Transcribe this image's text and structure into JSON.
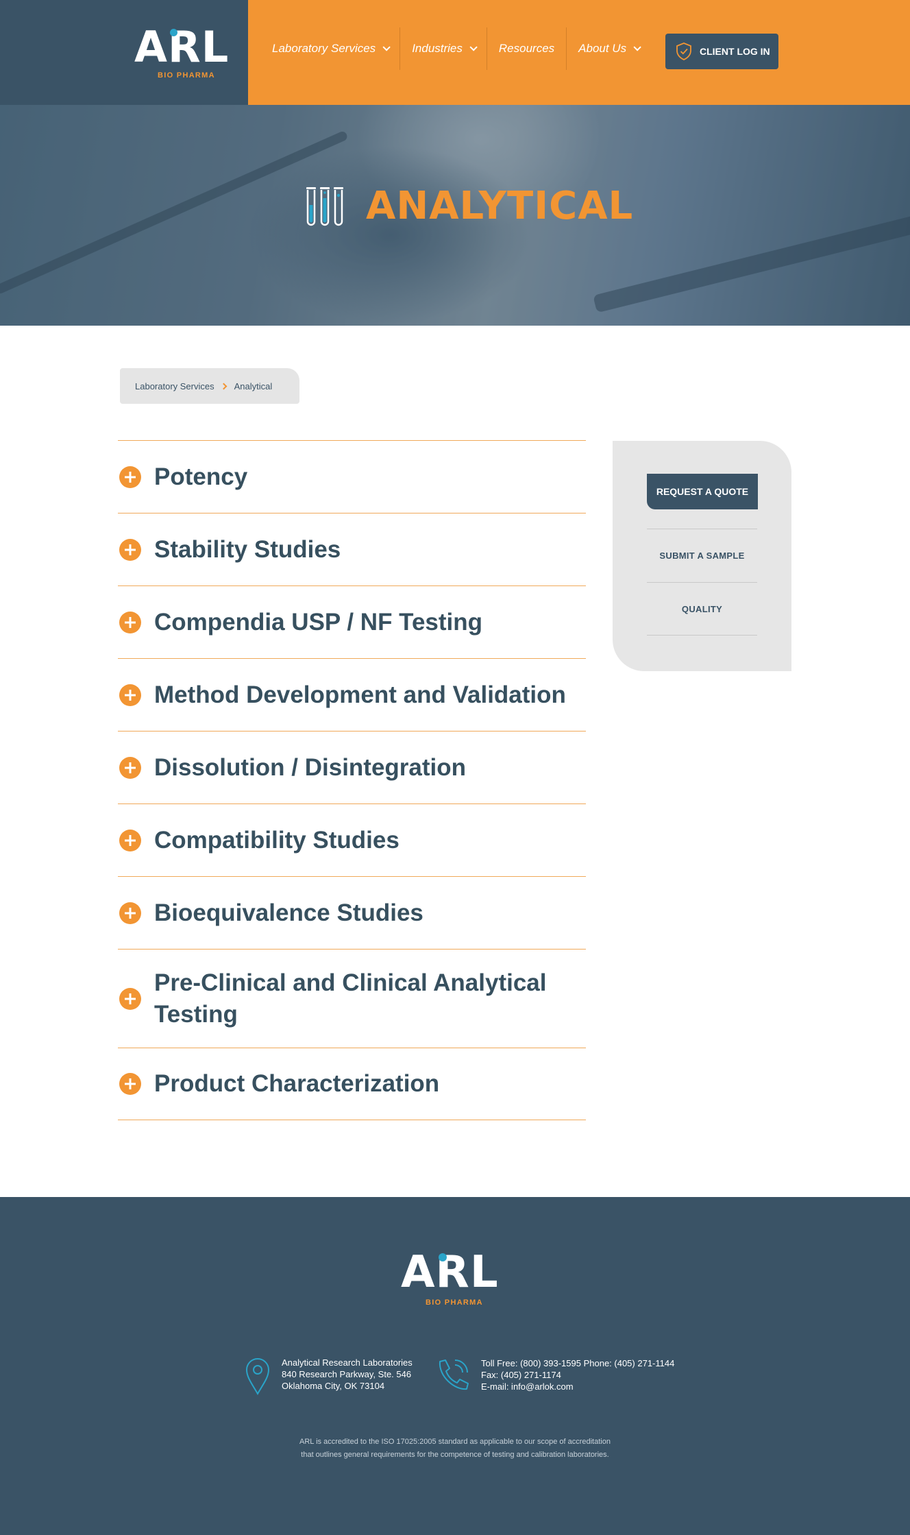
{
  "brand": {
    "logo_text": "ARL",
    "logo_subtitle": "BIO PHARMA",
    "primary_color": "#3a5366",
    "accent_color": "#f29533",
    "dot_color": "#2aa4c9"
  },
  "nav": {
    "items": [
      {
        "label": "Laboratory Services",
        "has_dropdown": true
      },
      {
        "label": "Industries",
        "has_dropdown": true
      },
      {
        "label": "Resources",
        "has_dropdown": false
      },
      {
        "label": "About Us",
        "has_dropdown": true
      }
    ],
    "client_login_label": "CLIENT LOG IN",
    "client_login_icon": "shield-check-icon"
  },
  "hero": {
    "title": "ANALYTICAL",
    "icon": "test-tubes-icon"
  },
  "breadcrumb": {
    "parent": "Laboratory Services",
    "current": "Analytical"
  },
  "accordion": {
    "items": [
      "Potency",
      "Stability Studies",
      "Compendia USP / NF Testing",
      "Method Development and Validation",
      "Dissolution / Disintegration",
      "Compatibility Studies",
      "Bioequivalence Studies",
      "Pre-Clinical and Clinical Analytical Testing",
      "Product Characterization"
    ]
  },
  "sidebar": {
    "quote_label": "REQUEST A QUOTE",
    "links": [
      "SUBMIT A SAMPLE",
      "QUALITY"
    ]
  },
  "footer": {
    "address": {
      "line1": "Analytical Research Laboratories",
      "line2": "840 Research Parkway, Ste. 546",
      "line3": "Oklahoma City, OK 73104"
    },
    "contact": {
      "line1": "Toll Free: (800) 393-1595 Phone: (405) 271-1144",
      "line2": "Fax: (405) 271-1174",
      "line3": "E-mail: info@arlok.com"
    },
    "note_line1": "ARL is accredited to the ISO 17025:2005 standard as applicable to our scope of accreditation",
    "note_line2": "that outlines general requirements for the competence of testing and calibration laboratories."
  }
}
